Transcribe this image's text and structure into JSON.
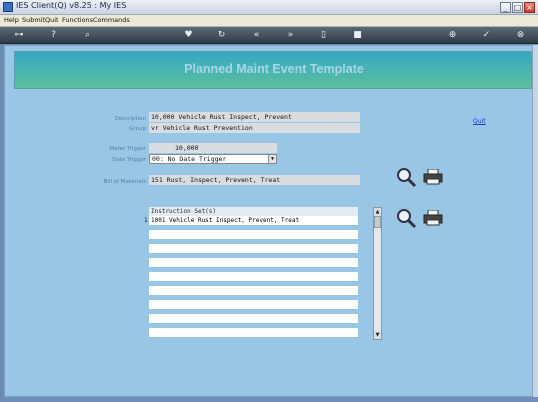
{
  "window": {
    "title": "IES Client(Q) v8.25 : My IES"
  },
  "menu": {
    "items": [
      "Help",
      "Submit",
      "Quit",
      "Functions",
      "Commands"
    ]
  },
  "toolbar": {
    "icons": [
      "key-icon",
      "help-icon",
      "search-icon",
      "heart-icon",
      "refresh-icon",
      "rewind-icon",
      "forward-icon",
      "trash-icon",
      "stop-icon",
      "add-icon",
      "check-icon",
      "close-icon"
    ]
  },
  "banner": {
    "title": "Planned Maint Event Template"
  },
  "form": {
    "description_label": "Description",
    "description_value": "10,000 Vehicle Rust Inspect, Prevent",
    "group_label": "Group",
    "group_value": "vr Vehicle Rust Prevention",
    "meter_trigger_label": "Meter Trigger",
    "meter_trigger_value": "10,000",
    "date_trigger_label": "Date Trigger",
    "date_trigger_value": "00: No Date Trigger",
    "bom_label": "Bill of Materials",
    "bom_value": "151 Rust, Inspect, Prevent, Treat",
    "quit_link": "Quit"
  },
  "instructions": {
    "header": "Instruction Set(s)",
    "row_number": "1",
    "rows": [
      "1001 Vehicle Rust Inspect, Prevent, Treat"
    ]
  },
  "colors": {
    "banner_start": "#34a8c4",
    "banner_end": "#5dbf9c",
    "workspace": "#9ac6e6"
  }
}
